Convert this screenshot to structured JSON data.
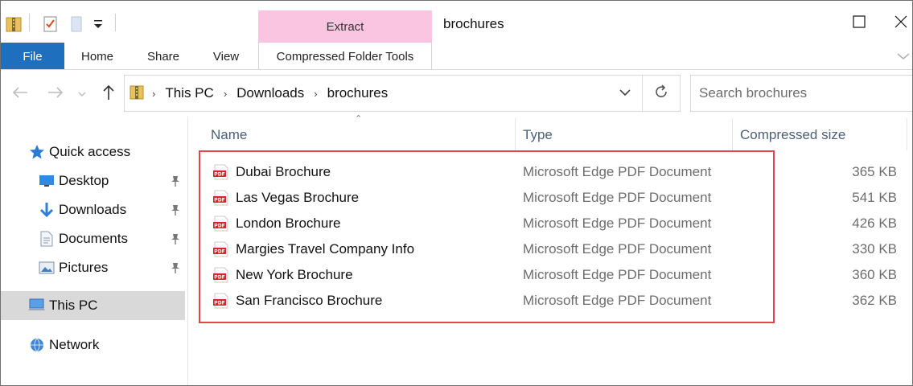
{
  "ribbon": {
    "context_group": "Extract",
    "window_title": "brochures",
    "tabs": {
      "file": "File",
      "home": "Home",
      "share": "Share",
      "view": "View",
      "compressed_tools": "Compressed Folder Tools"
    }
  },
  "address": {
    "crumbs": [
      "This PC",
      "Downloads",
      "brochures"
    ]
  },
  "search": {
    "placeholder": "Search brochures"
  },
  "nav": {
    "quick_access": "Quick access",
    "desktop": "Desktop",
    "downloads": "Downloads",
    "documents": "Documents",
    "pictures": "Pictures",
    "this_pc": "This PC",
    "network": "Network"
  },
  "columns": {
    "name": "Name",
    "type": "Type",
    "compressed_size": "Compressed size"
  },
  "files": [
    {
      "name": "Dubai Brochure",
      "type": "Microsoft Edge PDF Document",
      "size": "365 KB"
    },
    {
      "name": "Las Vegas Brochure",
      "type": "Microsoft Edge PDF Document",
      "size": "541 KB"
    },
    {
      "name": "London Brochure",
      "type": "Microsoft Edge PDF Document",
      "size": "426 KB"
    },
    {
      "name": "Margies Travel Company Info",
      "type": "Microsoft Edge PDF Document",
      "size": "330 KB"
    },
    {
      "name": "New York Brochure",
      "type": "Microsoft Edge PDF Document",
      "size": "360 KB"
    },
    {
      "name": "San Francisco Brochure",
      "type": "Microsoft Edge PDF Document",
      "size": "362 KB"
    }
  ],
  "colors": {
    "file_tab": "#1e6fbe",
    "context_band": "#f9c5e1",
    "highlight": "#e0464e",
    "selected": "#d9d9d9"
  }
}
